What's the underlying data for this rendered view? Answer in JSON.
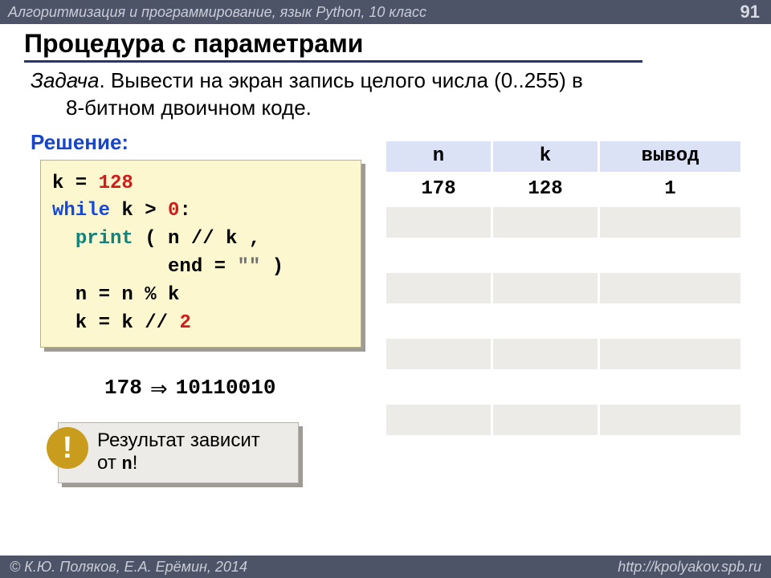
{
  "header": {
    "course": "Алгоритмизация и программирование, язык Python, 10 класс",
    "page_number": "91"
  },
  "footer": {
    "left": "© К.Ю. Поляков, Е.А. Ерёмин, 2014",
    "right": "http://kpolyakov.spb.ru"
  },
  "title": "Процедура с параметрами",
  "task": {
    "label": "Задача",
    "text_line1": ". Вывести на экран запись целого числа (0..255) в",
    "text_line2": "8-битном двоичном коде."
  },
  "solution_label": "Решение:",
  "code": {
    "l1a": "k = ",
    "l1b": "128",
    "l2a": "while",
    "l2b": " k > ",
    "l2c": "0",
    "l2d": ":",
    "l3a": "  ",
    "l3b": "print",
    "l3c": " ( n // k ,",
    "l4a": "          end = ",
    "l4b": "\"\"",
    "l4c": " )",
    "l5": "  n = n % k",
    "l6a": "  k = k // ",
    "l6b": "2"
  },
  "example": {
    "in": "178",
    "arrow": "⇒",
    "out": "10110010"
  },
  "callout": {
    "bang": "!",
    "line1": "Результат зависит",
    "line2a": "от ",
    "line2_mono": "n",
    "line2c": "!"
  },
  "table": {
    "headers": {
      "n": "n",
      "k": "k",
      "out": "вывод"
    },
    "row1": {
      "n": "178",
      "k": "128",
      "out": "1"
    }
  }
}
